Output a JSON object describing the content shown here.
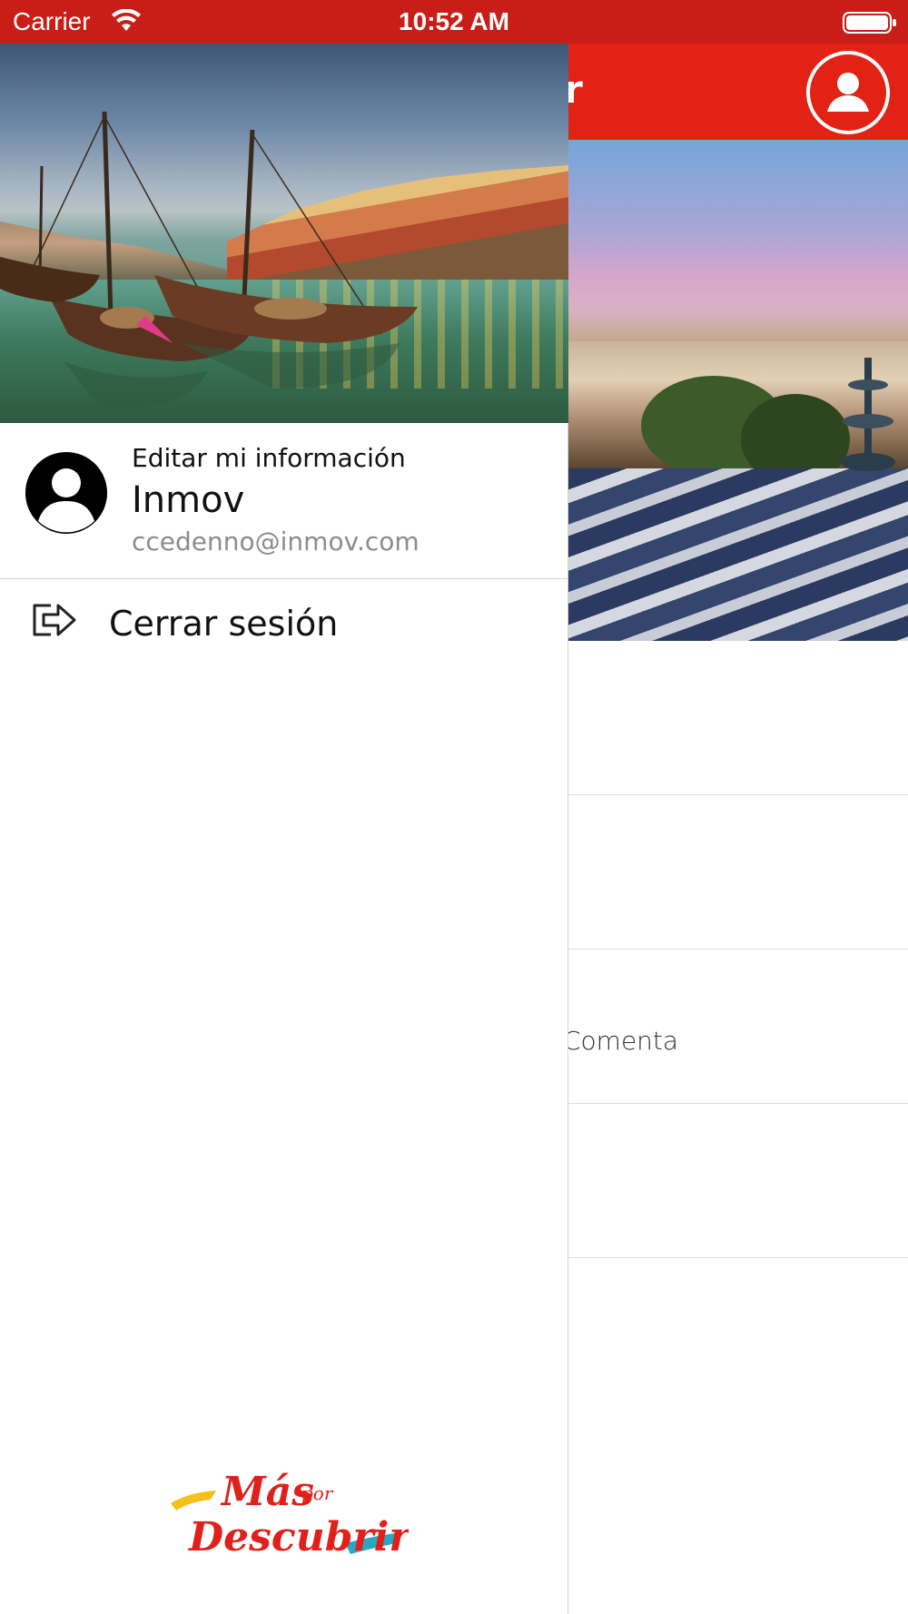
{
  "status_bar": {
    "carrier": "Carrier",
    "time": "10:52 AM"
  },
  "main_screen": {
    "header_title_fragment": "brir",
    "list_rows": [
      {
        "text": ""
      },
      {
        "text": ""
      },
      {
        "text": "Comenta"
      },
      {
        "text": ""
      }
    ]
  },
  "drawer": {
    "edit_label": "Editar mi información",
    "user_name": "Inmov",
    "user_email": "ccedenno@inmov.com",
    "logout_label": "Cerrar sesión",
    "logo_text_top": "Más",
    "logo_text_small": "por",
    "logo_text_bottom": "Descubrir"
  },
  "colors": {
    "status_bar": "#c81e17",
    "header": "#e22215",
    "logo_red": "#e0201a",
    "logo_yellow": "#f2c21b",
    "logo_teal": "#2aa7c0"
  },
  "icons": [
    "wifi-icon",
    "battery-icon",
    "profile-icon",
    "avatar-icon",
    "logout-icon"
  ]
}
